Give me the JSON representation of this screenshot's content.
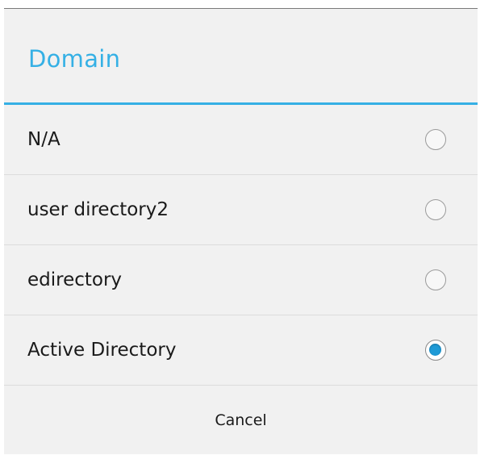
{
  "dialog": {
    "title": "Domain",
    "options": [
      {
        "label": "N/A",
        "selected": false
      },
      {
        "label": "user directory2",
        "selected": false
      },
      {
        "label": "edirectory",
        "selected": false
      },
      {
        "label": "Active Directory",
        "selected": true
      }
    ],
    "cancel_label": "Cancel"
  },
  "colors": {
    "accent": "#35b0e5",
    "radio_selected": "#1e9ad6",
    "dialog_background": "#f1f1f1"
  }
}
